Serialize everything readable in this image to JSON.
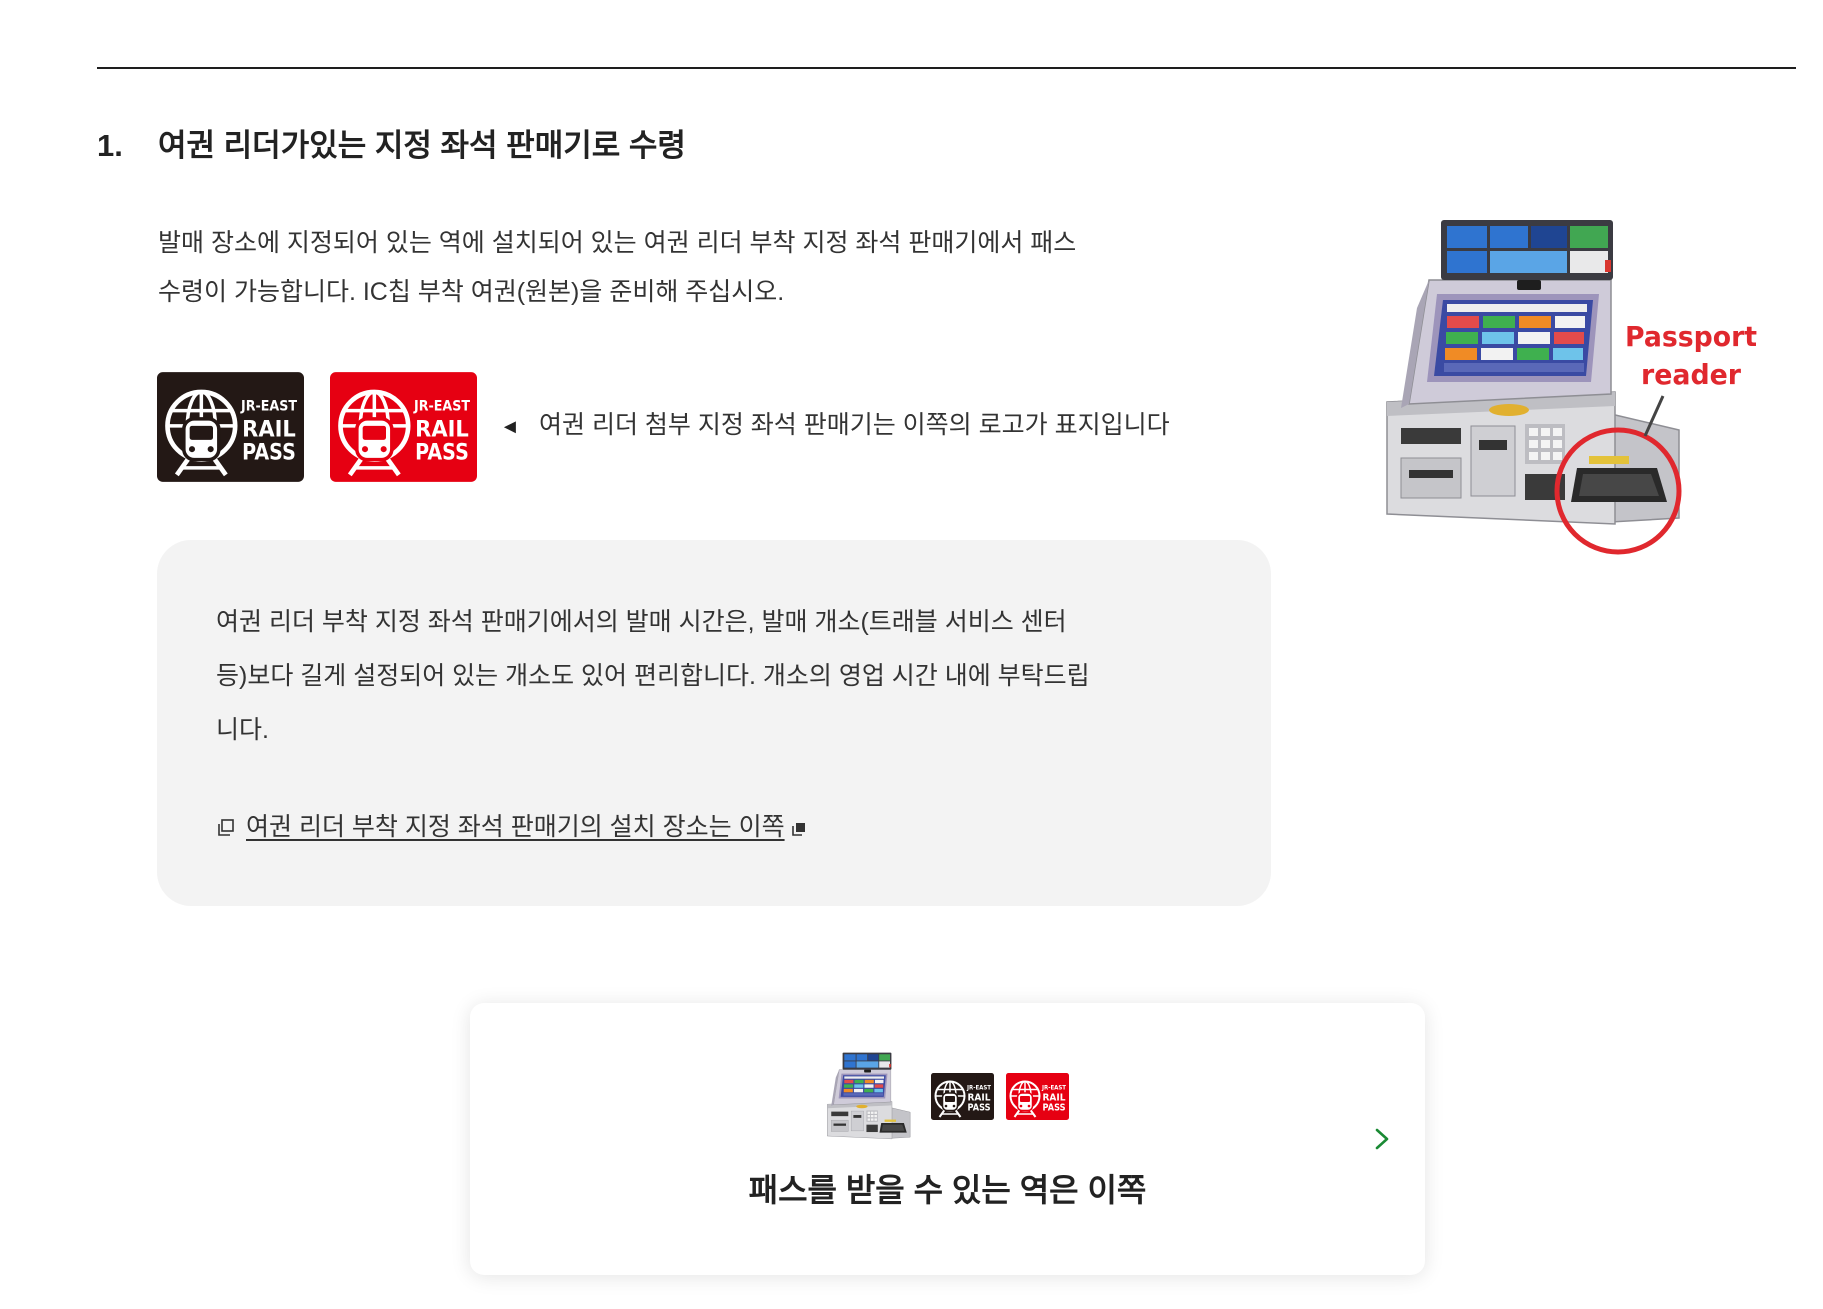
{
  "colors": {
    "text": "#333333",
    "heading": "#222222",
    "note_bg": "#f3f3f3",
    "logo_black": "#231815",
    "logo_red": "#e60012",
    "label_red": "#e0282e",
    "chevron_green": "#1a8a34"
  },
  "section": {
    "number": "1.",
    "title": "여권 리더가있는 지정 좌석 판매기로 수령",
    "intro_lines": [
      "발매 장소에 지정되어 있는 역에 설치되어 있는 여권 리더 부착 지정 좌석 판매기에서 패스",
      "수령이 가능합니다. IC칩 부착 여권(원본)을 준비해 주십시오."
    ]
  },
  "logo": {
    "line1": "JR-EAST",
    "line2": "RAIL",
    "line3": "PASS"
  },
  "logo_caption": {
    "arrow": "◄",
    "text": "여권 리더 첨부 지정 좌석 판매기는 이쪽의 로고가 표지입니다"
  },
  "machine_image": {
    "label_line1": "Passport",
    "label_line2": "reader"
  },
  "note_box": {
    "lines": [
      "여권 리더 부착 지정 좌석 판매기에서의 발매 시간은, 발매 개소(트래블 서비스 센터",
      "등)보다 길게 설정되어 있는 개소도 있어 편리합니다. 개소의 영업 시간 내에 부탁드립",
      "니다."
    ],
    "link_text": "여권 리더 부착 지정 좌석 판매기의 설치 장소는 이쪽",
    "link_icon_before": "document-icon",
    "link_icon_after": "external-link-icon"
  },
  "station_card": {
    "title": "패스를 받을 수 있는 역은 이쪽",
    "chevron_icon": "chevron-right-icon"
  }
}
